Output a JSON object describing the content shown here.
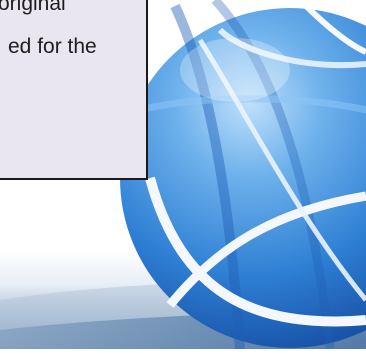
{
  "callout": {
    "line1": "original",
    "line2": "ed for the"
  },
  "image": {
    "globe_icon": "globe-icon",
    "floor_icon": "reflective-floor-icon"
  }
}
